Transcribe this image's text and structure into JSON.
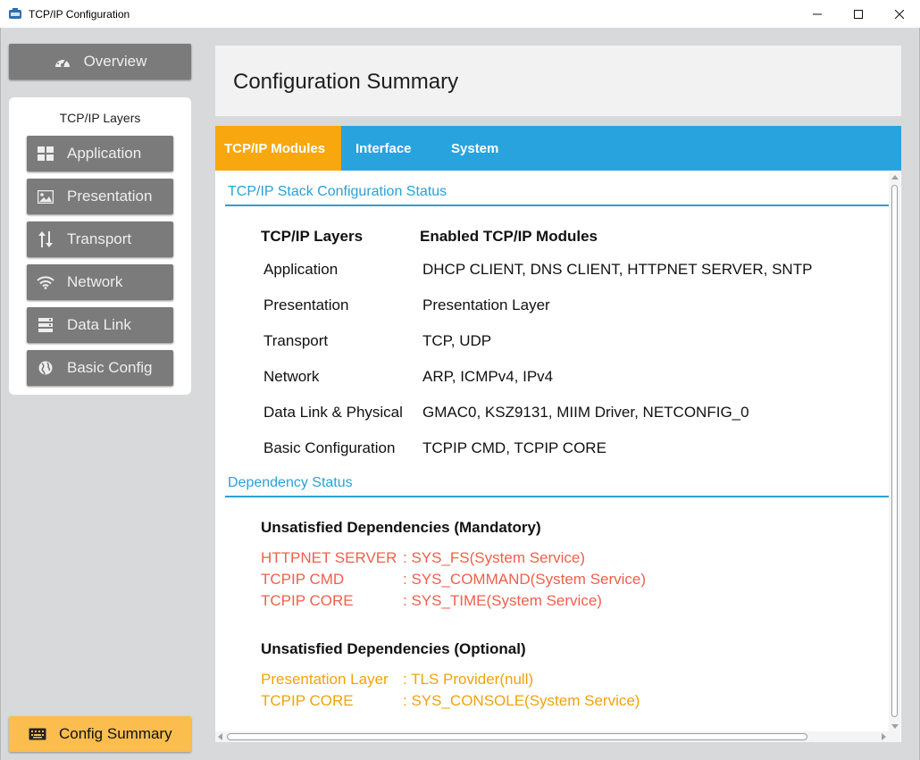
{
  "window": {
    "title": "TCP/IP Configuration",
    "minimize_icon": "minimize-icon",
    "maximize_icon": "maximize-icon",
    "close_icon": "close-icon"
  },
  "sidebar": {
    "overview_label": "Overview",
    "overview_icon": "speedometer-icon",
    "layers_title": "TCP/IP Layers",
    "layers": [
      {
        "label": "Application",
        "icon": "grid-icon"
      },
      {
        "label": "Presentation",
        "icon": "image-icon"
      },
      {
        "label": "Transport",
        "icon": "updown-arrows-icon"
      },
      {
        "label": "Network",
        "icon": "wifi-icon"
      },
      {
        "label": "Data Link",
        "icon": "server-icon"
      },
      {
        "label": "Basic Config",
        "icon": "globe-icon"
      }
    ],
    "summary_label": "Config Summary",
    "summary_icon": "keyboard-icon"
  },
  "main": {
    "header_title": "Configuration Summary",
    "tabs": [
      {
        "label": "TCP/IP Modules",
        "active": true
      },
      {
        "label": "Interface",
        "active": false
      },
      {
        "label": "System",
        "active": false
      }
    ],
    "stack_section": {
      "title": "TCP/IP Stack Configuration Status",
      "col_layers": "TCP/IP Layers",
      "col_modules": "Enabled TCP/IP Modules",
      "rows": [
        {
          "layer": "Application",
          "modules": "DHCP CLIENT, DNS CLIENT, HTTPNET SERVER, SNTP"
        },
        {
          "layer": "Presentation",
          "modules": "Presentation Layer"
        },
        {
          "layer": "Transport",
          "modules": "TCP, UDP"
        },
        {
          "layer": "Network",
          "modules": "ARP, ICMPv4, IPv4"
        },
        {
          "layer": "Data Link & Physical",
          "modules": "GMAC0, KSZ9131, MIIM Driver, NETCONFIG_0"
        },
        {
          "layer": "Basic Configuration",
          "modules": "TCPIP CMD, TCPIP CORE"
        }
      ]
    },
    "dependency_section": {
      "title": "Dependency Status",
      "mandatory_title": "Unsatisfied Dependencies (Mandatory)",
      "mandatory": [
        {
          "module": "HTTPNET SERVER",
          "dependency": ": SYS_FS(System Service)"
        },
        {
          "module": "TCPIP CMD",
          "dependency": ": SYS_COMMAND(System Service)"
        },
        {
          "module": "TCPIP CORE",
          "dependency": ": SYS_TIME(System Service)"
        }
      ],
      "optional_title": "Unsatisfied Dependencies (Optional)",
      "optional": [
        {
          "module": "Presentation Layer",
          "dependency": ": TLS Provider(null)"
        },
        {
          "module": "TCPIP CORE",
          "dependency": ": SYS_CONSOLE(System Service)"
        }
      ]
    }
  },
  "colors": {
    "tab_bar": "#29a3de",
    "tab_active": "#f9a70f",
    "mandatory_text": "#f0604a",
    "optional_text": "#f2a20c",
    "section_heading": "#2aa1d8",
    "summary_button": "#fbbd4e"
  }
}
